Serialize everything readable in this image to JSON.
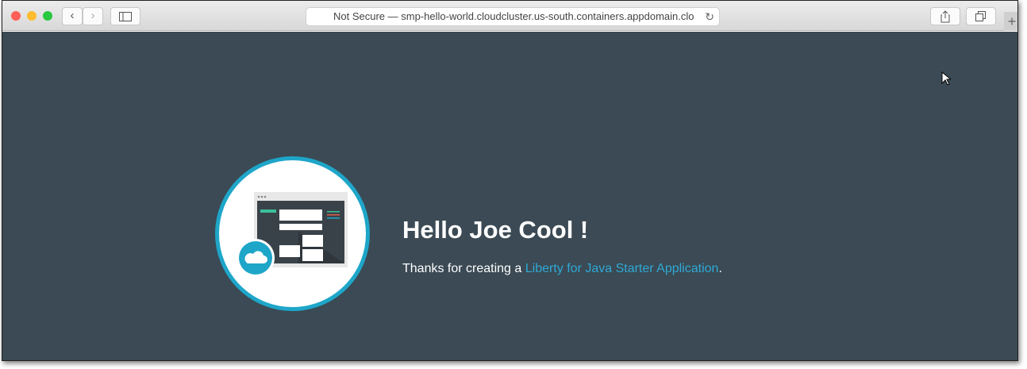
{
  "browser": {
    "url_text": "Not Secure — smp-hello-world.cloudcluster.us-south.containers.appdomain.clo",
    "back": "‹",
    "forward": "›",
    "reload": "↻",
    "new_tab": "+"
  },
  "page": {
    "heading": "Hello Joe Cool !",
    "text_before": "Thanks for creating a ",
    "link": "Liberty for Java Starter Application",
    "text_after": "."
  },
  "colors": {
    "background": "#3b4a54",
    "accent": "#1ea6c9",
    "link": "#2fa9d6"
  }
}
